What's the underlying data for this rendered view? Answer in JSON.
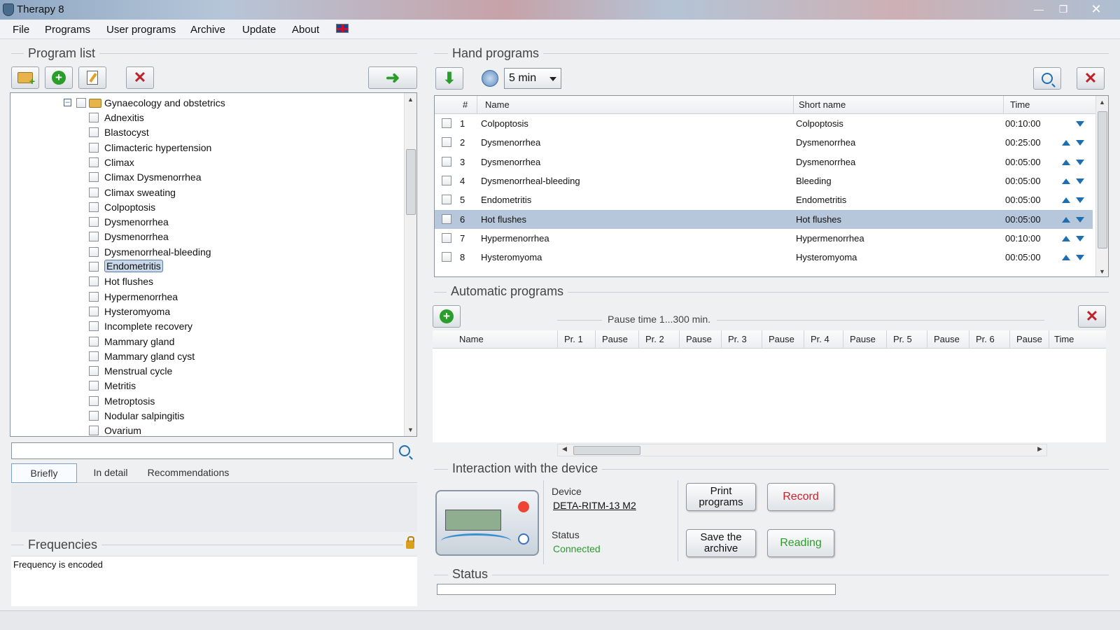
{
  "window": {
    "title": "Therapy 8"
  },
  "menu": [
    "File",
    "Programs",
    "User programs",
    "Archive",
    "Update",
    "About"
  ],
  "program_list": {
    "title": "Program list",
    "folder": "Gynaecology and obstetrics",
    "items": [
      "Adnexitis",
      "Blastocyst",
      "Climacteric  hypertension",
      "Climax",
      "Climax Dysmenorrhea",
      "Climax sweating",
      "Colpoptosis",
      "Dysmenorrhea",
      "Dysmenorrhea",
      "Dysmenorrheal-bleeding",
      "Endometritis",
      "Hot flushes",
      "Hypermenorrhea",
      "Hysteromyoma",
      "Incomplete recovery",
      "Mammary gland",
      "Mammary gland cyst",
      "Menstrual cycle",
      "Metritis",
      "Metroptosis",
      "Nodular salpingitis",
      "Ovarium"
    ],
    "selected_item": "Endometritis",
    "search_value": ""
  },
  "info_tabs": [
    "Briefly",
    "In detail",
    "Recommendations"
  ],
  "frequencies": {
    "title": "Frequencies",
    "text": "Frequency is encoded"
  },
  "hand_programs": {
    "title": "Hand programs",
    "time_value": "5 min",
    "columns": [
      "#",
      "Name",
      "Short name",
      "Time"
    ],
    "rows": [
      {
        "num": "1",
        "name": "Colpoptosis",
        "short": "Colpoptosis",
        "time": "00:10:00"
      },
      {
        "num": "2",
        "name": "Dysmenorrhea",
        "short": "Dysmenorrhea",
        "time": "00:25:00"
      },
      {
        "num": "3",
        "name": "Dysmenorrhea",
        "short": "Dysmenorrhea",
        "time": "00:05:00"
      },
      {
        "num": "4",
        "name": "Dysmenorrheal-bleeding",
        "short": "Bleeding",
        "time": "00:05:00"
      },
      {
        "num": "5",
        "name": "Endometritis",
        "short": "Endometritis",
        "time": "00:05:00"
      },
      {
        "num": "6",
        "name": "Hot flushes",
        "short": "Hot flushes",
        "time": "00:05:00"
      },
      {
        "num": "7",
        "name": "Hypermenorrhea",
        "short": "Hypermenorrhea",
        "time": "00:10:00"
      },
      {
        "num": "8",
        "name": "Hysteromyoma",
        "short": "Hysteromyoma",
        "time": "00:05:00"
      }
    ],
    "selected_row": "6"
  },
  "automatic_programs": {
    "title": "Automatic programs",
    "pause_label": "Pause time 1...300 min.",
    "columns": [
      "Name",
      "Pr. 1",
      "Pause",
      "Pr. 2",
      "Pause",
      "Pr. 3",
      "Pause",
      "Pr. 4",
      "Pause",
      "Pr. 5",
      "Pause",
      "Pr. 6",
      "Pause",
      "Time"
    ]
  },
  "interaction": {
    "title": "Interaction with the device",
    "device_label": "Device",
    "device_name": "DETA-RITM-13 M2",
    "status_label": "Status",
    "status_value": "Connected",
    "buttons": {
      "print": "Print programs",
      "record": "Record",
      "save_line1": "Save the",
      "save_line2": "archive",
      "reading": "Reading"
    }
  },
  "status": {
    "title": "Status"
  },
  "colors": {
    "accent_blue": "#1e6fb0",
    "green": "#2a9d2a",
    "red": "#c0202a",
    "selected_row": "#b6c7dc"
  }
}
